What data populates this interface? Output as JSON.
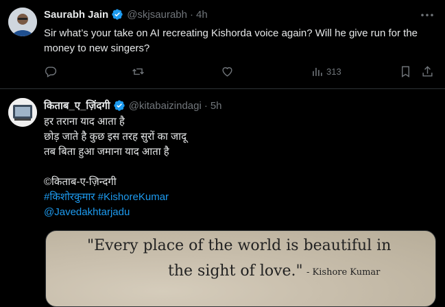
{
  "tweets": [
    {
      "name": "Saurabh Jain",
      "handle": "@skjsaurabh",
      "dot": "·",
      "time": "4h",
      "text": "Sir what’s your take on AI recreating Kishorda voice again? Will he give run for the money to new singers?",
      "actions": {
        "views": "313"
      }
    },
    {
      "name": "किताब_ए_ज़िंदगी",
      "handle": "@kitabaizindagi",
      "dot": "·",
      "time": "5h",
      "lines": [
        "हर तराना याद आता है",
        "छोड़ जाते है कुछ इस तरह सुरों का जादू",
        "तब बिता हुआ जमाना याद आता है",
        "",
        "©किताब-ए-ज़िन्दगी"
      ],
      "hashtags": "#किशोरकुमार #KishoreKumar",
      "mention": "@Javedakhtarjadu",
      "media": {
        "quote_line1": "\"Every place of the world is beautiful in",
        "quote_line2": "the sight of love.\"",
        "attribution": "- Kishore Kumar"
      }
    }
  ],
  "colors": {
    "background": "#000000",
    "text": "#e7e9ea",
    "muted": "#71767b",
    "link": "#1d9bf0",
    "verified": "#1d9bf0"
  }
}
